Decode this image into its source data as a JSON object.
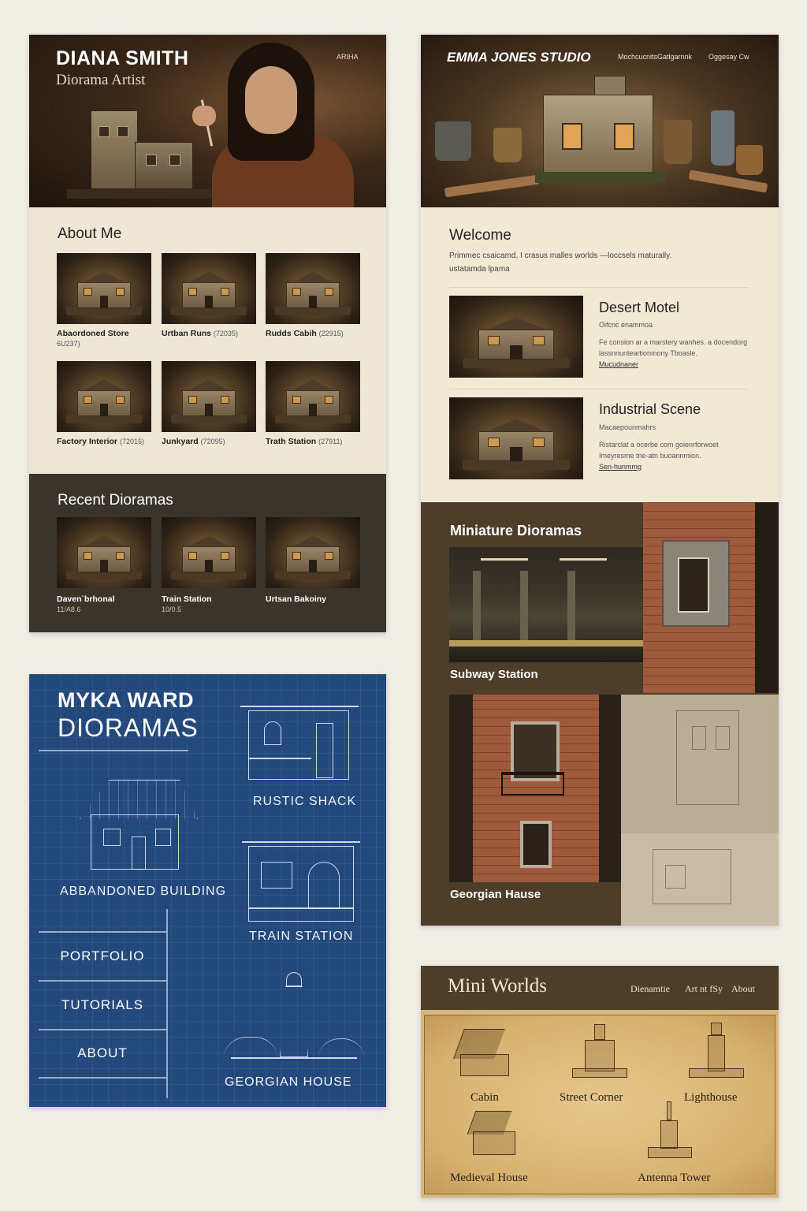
{
  "card1": {
    "name": "DIANA SMITH",
    "subtitle": "Diorama Artist",
    "nav_link": "ARIHA",
    "about_title": "About Me",
    "about_items": [
      {
        "title": "Abaordoned Store",
        "year": "6U237)"
      },
      {
        "title": "Urtban Runs",
        "year": "(72035)"
      },
      {
        "title": "Rudds Cabih",
        "year": "(22915)"
      },
      {
        "title": "Factory Interior",
        "year": "(72015)"
      },
      {
        "title": "Junkyard",
        "year": "(72095)"
      },
      {
        "title": "Trath Station",
        "year": "(27911)"
      }
    ],
    "recent_title": "Recent Dioramas",
    "recent_items": [
      {
        "title": "Daven`brhonal",
        "year": "11/A8.6"
      },
      {
        "title": "Train Station",
        "year": "10/0.5"
      },
      {
        "title": "Urtsan Bakoiny",
        "year": ""
      }
    ]
  },
  "card2": {
    "brand": "EMMA JONES STUDIO",
    "nav": [
      "Mochcucnits",
      "Gatlgarnnk",
      "Oggesay Cw"
    ],
    "welcome_title": "Welcome",
    "intro_lines": [
      "Primmec csaicamd, I crasus malles worlds —loccsels maturally.",
      "ustatamda lpama"
    ],
    "features": [
      {
        "title": "Desert Motel",
        "subtitle": "Oifcnc enammoa",
        "desc_lines": [
          "Fe consion ar a marstery wanhes. a docendorg",
          "lassnnunteartionmony Tboasle."
        ],
        "link": "Mucudnaner"
      },
      {
        "title": "Industrial Scene",
        "subtitle": "Macaepounmahrs",
        "desc_lines": [
          "Ristarclat a ocerbe com goienrforwoet",
          "Imeyresme tne-atn buoannmion."
        ],
        "link": "Sen-hunmmg"
      }
    ],
    "mini_title": "Miniature Dioramas",
    "gallery": [
      {
        "label": "Subway Station"
      },
      {
        "label": "Georgian Hause"
      }
    ]
  },
  "card3": {
    "title1": "MYKA WARD",
    "title2": "DIORAMAS",
    "labels": {
      "abandoned": "ABBANDONED BUILDING",
      "rustic": "RUSTIC SHACK",
      "train": "TRAIN STATION",
      "georgian": "GEORGIAN HOUSE"
    },
    "nav": [
      "PORTFOLIO",
      "TUTORIALS",
      "ABOUT"
    ]
  },
  "card4": {
    "brand": "Mini Worlds",
    "nav": [
      "Dienamtie",
      "Art nt fSy",
      "About"
    ],
    "items": [
      "Cabin",
      "Street Corner",
      "Lighthouse",
      "Medieval House",
      "Antenna Tower"
    ]
  },
  "colors": {
    "background": "#f1eee6",
    "diana_cream": "#efe7d6",
    "diana_dark": "#3b342a",
    "emma_cream": "#f1e9d4",
    "emma_brown": "#4e3d28",
    "blueprint": "#23497c",
    "parchment": "#d9b779"
  },
  "icons": [
    "diorama-thumbnail",
    "blueprint-house",
    "blueprint-lighthouse",
    "etched-cabin",
    "etched-lighthouse"
  ]
}
